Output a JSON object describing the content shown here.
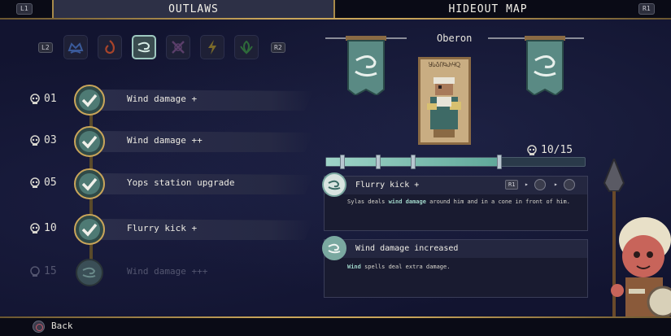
{
  "tabs": {
    "left_trigger": "L1",
    "right_trigger": "R1",
    "outlaws": "OUTLAWS",
    "hideout_map": "HIDEOUT MAP"
  },
  "element_selector": {
    "prev_trigger": "L2",
    "next_trigger": "R2",
    "icons": [
      "water-crown-icon",
      "fire-swirl-icon",
      "wind-spiral-icon",
      "cross-swords-icon",
      "lightning-icon",
      "leaf-crown-icon"
    ],
    "selected": "wind-spiral-icon"
  },
  "upgrades": [
    {
      "level": "01",
      "label": "Wind damage +",
      "unlocked": true
    },
    {
      "level": "03",
      "label": "Wind damage ++",
      "unlocked": true
    },
    {
      "level": "05",
      "label": "Yops station upgrade",
      "unlocked": true
    },
    {
      "level": "10",
      "label": "Flurry kick +",
      "unlocked": true
    },
    {
      "level": "15",
      "label": "Wind damage +++",
      "unlocked": false
    }
  ],
  "outlaw": {
    "name": "Oberon",
    "portrait_runes": "ႸႱჂႶႩႰႷႭ",
    "progress_text": "10/15",
    "progress_fraction": 0.667
  },
  "details": {
    "skill_title": "Flurry kick +",
    "skill_controls": {
      "button": "R1",
      "arrow1": "▸",
      "arrow2": "▸"
    },
    "skill_desc_pre": "Sylas deals ",
    "skill_desc_bold": "wind damage",
    "skill_desc_post": " around him and in a cone in front of him.",
    "passive_title": "Wind damage increased",
    "passive_desc_bold": "Wind",
    "passive_desc_post": " spells deal extra damage."
  },
  "footer": {
    "back_label": "Back"
  },
  "colors": {
    "accent_gold": "#c9a55a",
    "wind_teal": "#9fd4c8",
    "panel_bg": "#191b30"
  }
}
